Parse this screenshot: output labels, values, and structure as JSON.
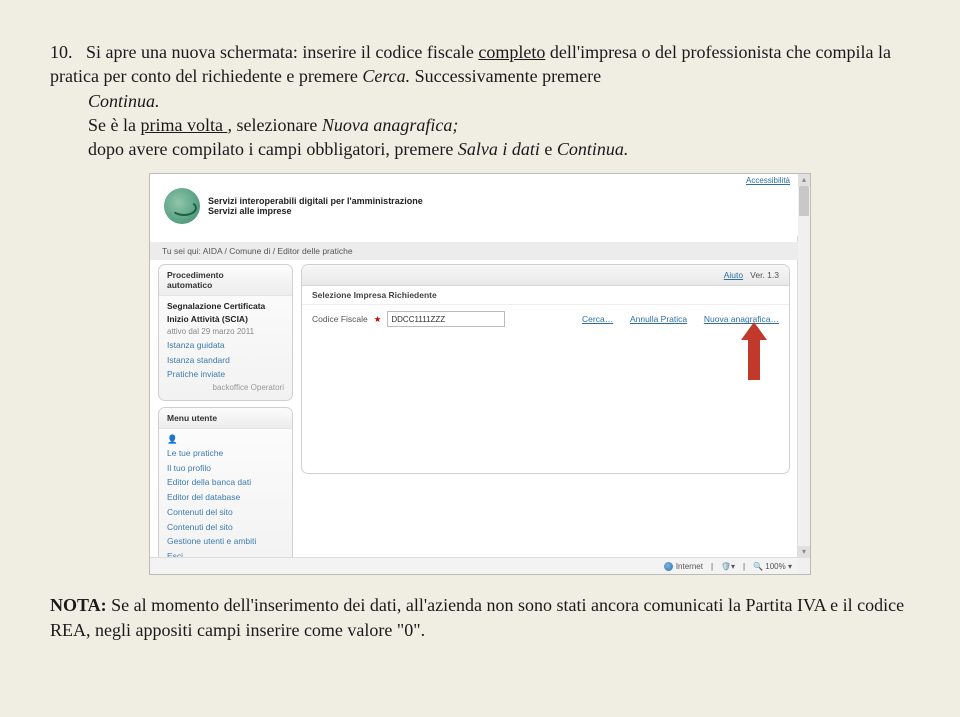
{
  "para": {
    "num": "10.",
    "line1_a": "Si apre una nuova schermata: inserire il codice fiscale ",
    "line1_u": "completo",
    "line1_b": " dell'impresa o del professionista che compila la pratica  per conto del richiedente e premere ",
    "line1_i1": "Cerca.",
    "line1_c": " Successivamente premere ",
    "line1_i2": "Continua.",
    "line2_a": "Se è la ",
    "line2_u": "prima volta ",
    "line2_b": ", selezionare ",
    "line2_i1": "Nuova anagrafica;",
    "line3_a": "dopo avere compilato i campi obbligatori, premere ",
    "line3_i1": "Salva i dati",
    "line3_b": " e ",
    "line3_i2": "Continua."
  },
  "shot": {
    "access": "Accessibilità",
    "brand_l1": "Servizi interoperabili digitali per l'amministrazione",
    "brand_l2": "Servizi alle imprese",
    "breadcrumb": "Tu sei qui: AIDA / Comune di                       / Editor delle pratiche",
    "side1": {
      "hdr": "Procedimento\nautomatico",
      "bold": "Segnalazione Certificata Inizio Attività (SCIA)",
      "sub": "attivo dal 29 marzo 2011",
      "items": [
        "Istanza guidata",
        "Istanza standard",
        "Pratiche inviate"
      ],
      "back": "backoffice Operatori"
    },
    "side2": {
      "hdr": "Menu utente",
      "items": [
        "Le tue pratiche",
        "Il tuo profilo",
        "Editor della banca dati",
        "Editor del database",
        "Contenuti del sito",
        "Contenuti del sito",
        "Gestione utenti e ambiti",
        "Esci"
      ]
    },
    "main": {
      "aiuto": "Aiuto",
      "ver": "Ver. 1.3",
      "section": "Selezione Impresa Richiedente",
      "cflabel": "Codice Fiscale",
      "cfvalue": "DDCC1111ZZZ",
      "cerca": "Cerca…",
      "annulla": "Annulla Pratica",
      "nuova": "Nuova anagrafica…"
    },
    "status": {
      "internet": "Internet",
      "zoom": "100%"
    }
  },
  "nota": {
    "lead": "NOTA:",
    "text": " Se al momento dell'inserimento dei dati, all'azienda non sono stati ancora comunicati la Partita IVA e il codice REA, negli appositi campi inserire come valore \"0\"."
  }
}
